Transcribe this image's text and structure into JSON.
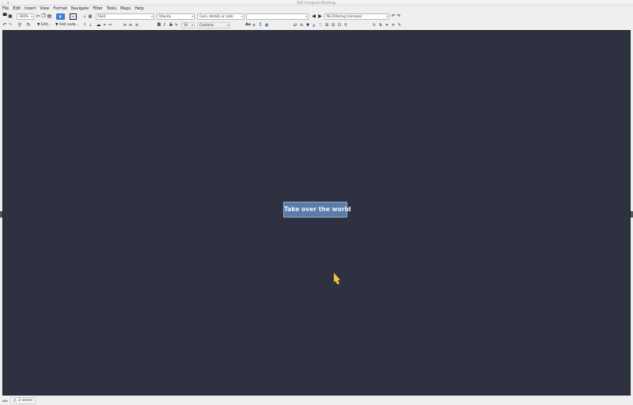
{
  "window": {
    "title": "M1F-Freeplane Mindmap"
  },
  "menu": [
    "File",
    "Edit",
    "Insert",
    "View",
    "Format",
    "Navigate",
    "Filter",
    "Tools",
    "Maps",
    "Help"
  ],
  "toolbar": {
    "zoom": "100%",
    "edit_label": "Edit...",
    "add_node_label": "Add node...",
    "style_select": "Root",
    "font_select": "Ubuntu",
    "search_scope_select": "Core, details or note",
    "search_input": "",
    "filter_select": "No Filtering (remove)",
    "match_select": "Contains",
    "font_size": "10",
    "case_label": "Aa",
    "bold_label": "B",
    "italic_label": "I",
    "strike_label": "S"
  },
  "map": {
    "root_node_text": "Take over the world",
    "background_color": "#2e3140",
    "node_color": "#5a7ca8"
  },
  "status": {
    "mode_label": "Abc",
    "errors_label": "2 errors"
  }
}
